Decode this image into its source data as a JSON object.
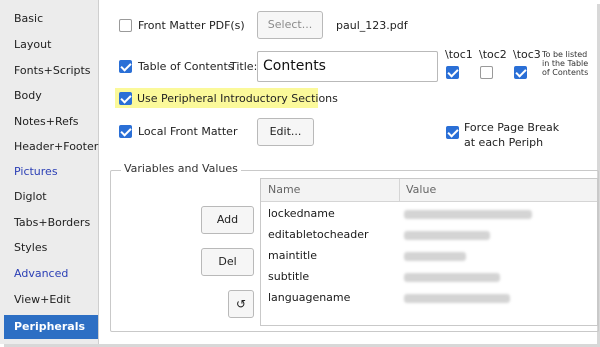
{
  "sidebar": {
    "items": [
      {
        "label": "Basic"
      },
      {
        "label": "Layout"
      },
      {
        "label": "Fonts+Scripts"
      },
      {
        "label": "Body"
      },
      {
        "label": "Notes+Refs"
      },
      {
        "label": "Header+Footer"
      },
      {
        "label": "Pictures"
      },
      {
        "label": "Diglot"
      },
      {
        "label": "Tabs+Borders"
      },
      {
        "label": "Styles"
      },
      {
        "label": "Advanced"
      },
      {
        "label": "View+Edit"
      },
      {
        "label": "Peripherals"
      }
    ]
  },
  "front_matter_pdf": {
    "label": "Front Matter PDF(s)",
    "checked": false,
    "select_label": "Select...",
    "filename": "paul_123.pdf"
  },
  "toc": {
    "label": "Table of Contents",
    "checked": true,
    "title_label": "Title:",
    "title_value": "Contents",
    "toc1": "\\toc1",
    "toc2": "\\toc2",
    "toc3": "\\toc3",
    "note": [
      "To be listed",
      "in the Table",
      "of Contents"
    ]
  },
  "use_peripheral": {
    "label": "Use Peripheral Introductory Sections",
    "checked": true,
    "highlight_color": "#fbf99a"
  },
  "local_front_matter": {
    "label": "Local Front Matter",
    "checked": true,
    "edit_label": "Edit..."
  },
  "force_page_break": {
    "label_line1": "Force Page Break",
    "label_line2": "at each Periph",
    "checked": true
  },
  "variables": {
    "group_title": "Variables and Values",
    "add_label": "Add",
    "del_label": "Del",
    "refresh_icon": "↺",
    "columns": {
      "name": "Name",
      "value": "Value"
    },
    "rows": [
      {
        "name": "lockedname"
      },
      {
        "name": "editabletocheader"
      },
      {
        "name": "maintitle"
      },
      {
        "name": "subtitle"
      },
      {
        "name": "languagename"
      }
    ]
  },
  "colors": {
    "accent": "#2d6fc4",
    "checkbox": "#2a6fd6",
    "link_blue": "#2b3fb5"
  }
}
